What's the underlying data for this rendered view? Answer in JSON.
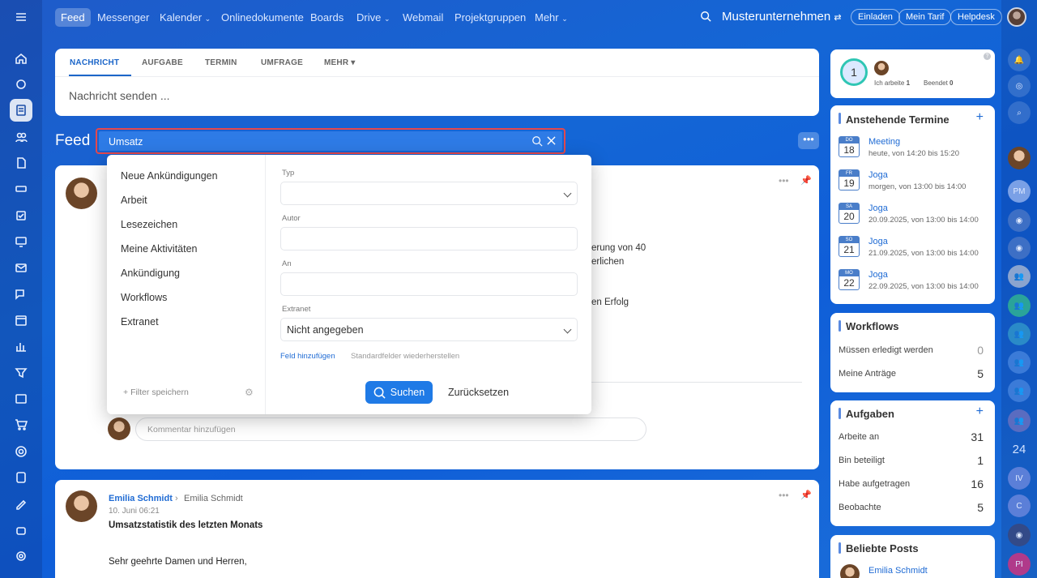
{
  "topbar": {
    "nav": [
      "Feed",
      "Messenger",
      "Kalender",
      "Onlinedokumente",
      "Boards",
      "Drive",
      "Webmail",
      "Projektgruppen",
      "Mehr"
    ],
    "company": "Musterunternehmen",
    "buttons": [
      "Einladen",
      "Mein Tarif",
      "Helpdesk"
    ]
  },
  "composer": {
    "tabs": [
      "NACHRICHT",
      "AUFGABE",
      "TERMIN",
      "UMFRAGE",
      "MEHR"
    ],
    "placeholder": "Nachricht senden ..."
  },
  "feed": {
    "title": "Feed",
    "search_value": "Umsatz"
  },
  "filter": {
    "presets": [
      "Neue Ankündigungen",
      "Arbeit",
      "Lesezeichen",
      "Meine Aktivitäten",
      "Ankündigung",
      "Workflows",
      "Extranet"
    ],
    "save_filter": "Filter speichern",
    "fields": {
      "type_label": "Typ",
      "author_label": "Autor",
      "to_label": "An",
      "extranet_label": "Extranet",
      "extranet_value": "Nicht angegeben"
    },
    "add_field": "Feld hinzufügen",
    "restore_fields": "Standardfelder wiederherstellen",
    "search_btn": "Suchen",
    "reset_btn": "Zurücksetzen"
  },
  "post1": {
    "text_fragments": [
      "erung von 40",
      "erlichen",
      "en Erfolg"
    ],
    "comment_placeholder": "Kommentar hinzufügen"
  },
  "post2": {
    "author": "Emilia Schmidt",
    "recipient": "Emilia Schmidt",
    "date": "10. Juni 06:21",
    "title": "Umsatzstatistik des letzten Monats",
    "body": "Sehr geehrte Damen und Herren,"
  },
  "worktime": {
    "count": "1",
    "working_label": "Ich arbeite",
    "working_count": "1",
    "ended_label": "Beendet",
    "ended_count": "0"
  },
  "events": {
    "title": "Anstehende Termine",
    "items": [
      {
        "dow": "DO",
        "day": "18",
        "title": "Meeting",
        "when": "heute, von 14:20 bis 15:20"
      },
      {
        "dow": "FR",
        "day": "19",
        "title": "Joga",
        "when": "morgen, von 13:00 bis 14:00"
      },
      {
        "dow": "SA",
        "day": "20",
        "title": "Joga",
        "when": "20.09.2025, von 13:00 bis 14:00"
      },
      {
        "dow": "SO",
        "day": "21",
        "title": "Joga",
        "when": "21.09.2025, von 13:00 bis 14:00"
      },
      {
        "dow": "MO",
        "day": "22",
        "title": "Joga",
        "when": "22.09.2025, von 13:00 bis 14:00"
      }
    ]
  },
  "workflows": {
    "title": "Workflows",
    "rows": [
      {
        "label": "Müssen erledigt werden",
        "value": "0"
      },
      {
        "label": "Meine Anträge",
        "value": "5"
      }
    ]
  },
  "tasks": {
    "title": "Aufgaben",
    "rows": [
      {
        "label": "Arbeite an",
        "value": "31"
      },
      {
        "label": "Bin beteiligt",
        "value": "1"
      },
      {
        "label": "Habe aufgetragen",
        "value": "16"
      },
      {
        "label": "Beobachte",
        "value": "5"
      }
    ]
  },
  "popular": {
    "title": "Beliebte Posts",
    "author": "Emilia Schmidt"
  },
  "rrail": {
    "labels": [
      "PM",
      "24",
      "IV",
      "C",
      "PI"
    ]
  }
}
